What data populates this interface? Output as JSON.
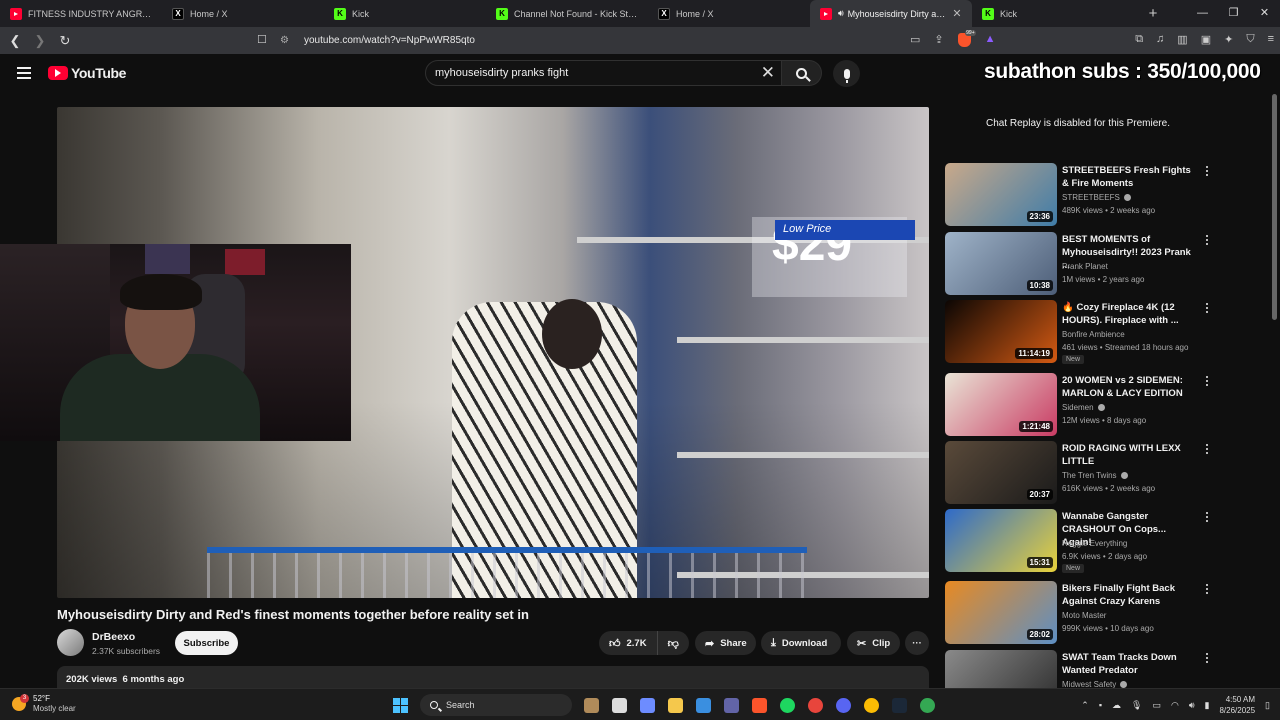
{
  "browser": {
    "tabs": [
      {
        "label": "FITNESS INDUSTRY ANGRY RANT",
        "favicon": "youtube-favicon",
        "active": false
      },
      {
        "label": "Home / X",
        "favicon": "x-favicon",
        "active": false
      },
      {
        "label": "Kick",
        "favicon": "kick-favicon",
        "active": false
      },
      {
        "label": "Channel Not Found - Kick Streaming",
        "favicon": "kick-favicon",
        "active": false
      },
      {
        "label": "Home / X",
        "favicon": "x-favicon",
        "active": false
      },
      {
        "label": "Myhouseisdirty Dirty and Red's",
        "favicon": "youtube-favicon",
        "active": true
      },
      {
        "label": "Kick",
        "favicon": "kick-favicon",
        "active": false
      }
    ],
    "url": "youtube.com/watch?v=NpPwWR85qto",
    "brave_badge": "99+"
  },
  "youtube": {
    "logo_text": "YouTube",
    "search": {
      "value": "myhouseisdirty pranks fight",
      "placeholder": "Search"
    },
    "overlay_text": "subathon subs : 350/100,000",
    "chat_message": "Chat Replay is disabled for this Premiere.",
    "video": {
      "title": "Myhouseisdirty Dirty and Red's finest moments together before reality set in",
      "channel": "DrBeexo",
      "subscribers": "2.37K subscribers",
      "subscribe_label": "Subscribe",
      "likes": "2.7K",
      "share_label": "Share",
      "download_label": "Download",
      "clip_label": "Clip",
      "views": "202K views",
      "age": "6 months ago"
    },
    "recommendations": [
      {
        "title": "STREETBEEFS Fresh Fights & Fire Moments",
        "channel": "STREETBEEFS",
        "verified": true,
        "views": "489K views",
        "age": "2 weeks ago",
        "duration": "23:36",
        "new": false,
        "thumb_colors": [
          "#c9a98a",
          "#3f7ca8"
        ]
      },
      {
        "title": "BEST MOMENTS of Myhouseisdirty!! 2023 Prank ...",
        "channel": "Prank Planet",
        "verified": false,
        "views": "1M views",
        "age": "2 years ago",
        "duration": "10:38",
        "new": false,
        "thumb_colors": [
          "#9fb3c8",
          "#4d5e78"
        ]
      },
      {
        "title": "🔥 Cozy Fireplace 4K (12 HOURS). Fireplace with ...",
        "channel": "Bonfire Ambience",
        "verified": false,
        "views": "461 views",
        "age": "Streamed 18 hours ago",
        "duration": "11:14:19",
        "new": true,
        "thumb_colors": [
          "#0b0604",
          "#d45a13"
        ]
      },
      {
        "title": "20 WOMEN vs 2 SIDEMEN: MARLON & LACY EDITION",
        "channel": "Sidemen",
        "verified": true,
        "views": "12M views",
        "age": "8 days ago",
        "duration": "1:21:48",
        "new": false,
        "thumb_colors": [
          "#e9e4d6",
          "#c93b63"
        ]
      },
      {
        "title": "ROID RAGING WITH LEXX LITTLE",
        "channel": "The Tren Twins",
        "verified": true,
        "views": "616K views",
        "age": "2 weeks ago",
        "duration": "20:37",
        "new": false,
        "thumb_colors": [
          "#5a4a3a",
          "#1a1a1a"
        ]
      },
      {
        "title": "Wannabe Gangster CRASHOUT On Cops... Again!",
        "channel": "Reggie Everything",
        "verified": false,
        "views": "6.9K views",
        "age": "2 days ago",
        "duration": "15:31",
        "new": true,
        "thumb_colors": [
          "#2e6ac9",
          "#e8d23b"
        ]
      },
      {
        "title": "Bikers Finally Fight Back Against Crazy Karens",
        "channel": "Moto Master",
        "verified": false,
        "views": "999K views",
        "age": "10 days ago",
        "duration": "28:02",
        "new": false,
        "thumb_colors": [
          "#e88a22",
          "#5d8fc4"
        ]
      },
      {
        "title": "SWAT Team Tracks Down Wanted Predator",
        "channel": "Midwest Safety",
        "verified": true,
        "views": "",
        "age": "",
        "duration": "",
        "new": false,
        "thumb_colors": [
          "#8a8a8a",
          "#2a2a2a"
        ]
      }
    ],
    "new_badge_label": "New"
  },
  "taskbar": {
    "weather_temp": "52°F",
    "weather_cond": "Mostly clear",
    "weather_badge": "3",
    "search_label": "Search",
    "time": "4:50 AM",
    "date": "8/26/2025",
    "apps": [
      {
        "name": "cat-widget-icon",
        "color": "#b08b5a"
      },
      {
        "name": "task-view-icon",
        "color": "#dddddd"
      },
      {
        "name": "copilot-icon",
        "color": "#6d8cff"
      },
      {
        "name": "file-explorer-icon",
        "color": "#f5c84c"
      },
      {
        "name": "store-icon",
        "color": "#3a8fe0"
      },
      {
        "name": "teams-icon",
        "color": "#6264a7"
      },
      {
        "name": "brave-icon",
        "color": "#fb542b"
      },
      {
        "name": "spotify-icon",
        "color": "#1ed760"
      },
      {
        "name": "chrome-icon",
        "color": "#e8453c"
      },
      {
        "name": "discord-icon",
        "color": "#5865f2"
      },
      {
        "name": "chrome-alt-icon",
        "color": "#fbbc04"
      },
      {
        "name": "steam-icon",
        "color": "#1b2838"
      },
      {
        "name": "chrome-profile-icon",
        "color": "#34a853"
      }
    ]
  }
}
